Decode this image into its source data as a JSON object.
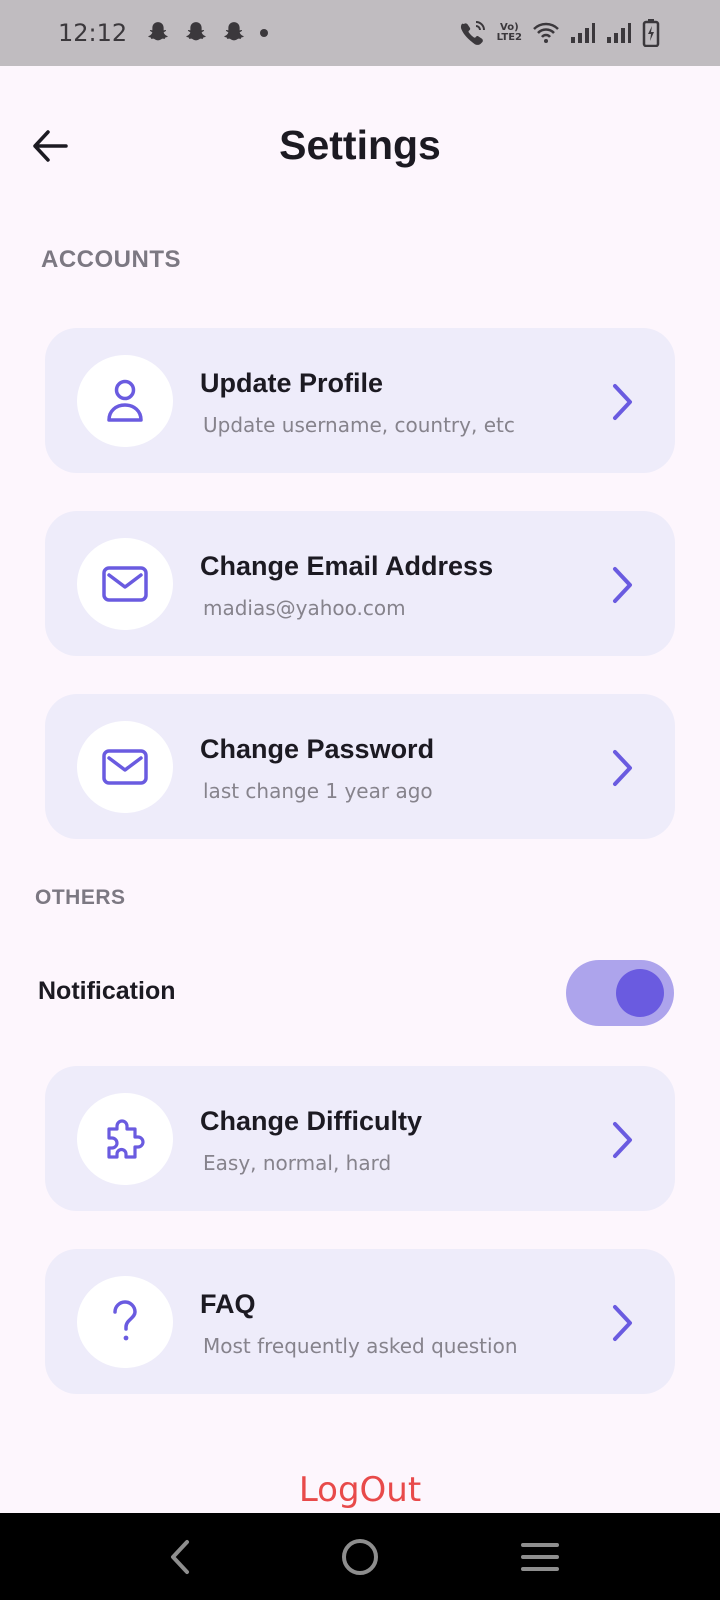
{
  "status_bar": {
    "time": "12:12",
    "lte_line1": "Vo)",
    "lte_line2": "LTE2"
  },
  "header": {
    "title": "Settings"
  },
  "sections": {
    "accounts_label": "ACCOUNTS",
    "others_label": "OTHERS"
  },
  "items": [
    {
      "title": "Update Profile",
      "subtitle": "Update username, country, etc",
      "icon": "user-icon"
    },
    {
      "title": "Change Email Address",
      "subtitle": "madias@yahoo.com",
      "icon": "mail-icon"
    },
    {
      "title": "Change Password",
      "subtitle": "last change 1 year ago",
      "icon": "mail-icon"
    },
    {
      "title": "Change Difficulty",
      "subtitle": "Easy, normal, hard",
      "icon": "puzzle-icon"
    },
    {
      "title": "FAQ",
      "subtitle": "Most frequently asked question",
      "icon": "question-icon"
    }
  ],
  "notification": {
    "label": "Notification",
    "enabled": true
  },
  "logout_label": "LogOut",
  "colors": {
    "accent": "#6a5be0",
    "card_bg": "#eeecfa",
    "page_bg": "#fdf6fd",
    "logout": "#e84a4a"
  }
}
